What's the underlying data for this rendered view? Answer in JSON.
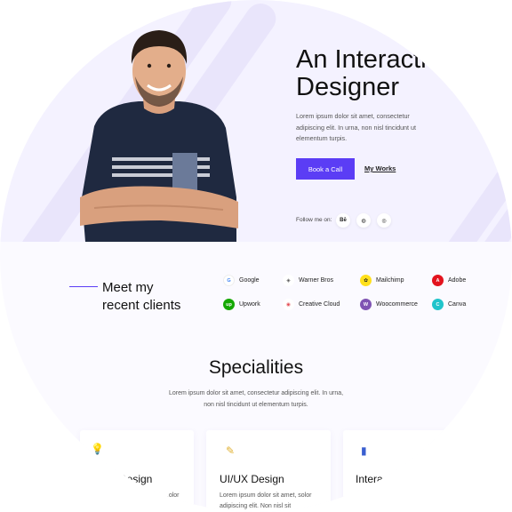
{
  "hero": {
    "headline_line1": "An Interactiv",
    "headline_line2": "Designer",
    "description": "Lorem ipsum dolor sit amet, consectetur adipiscing elit. In urna, non nisl tincidunt ut elementum turpis.",
    "primary_button": "Book a Call",
    "secondary_link": "My Works",
    "follow_label": "Follow me on:",
    "social": [
      {
        "icon": "behance-icon",
        "glyph": "Bē"
      },
      {
        "icon": "dribbble-icon",
        "glyph": "◍"
      },
      {
        "icon": "instagram-icon",
        "glyph": "◎"
      }
    ]
  },
  "clients": {
    "title_line1": "Meet my",
    "title_line2": "recent clients",
    "items": [
      {
        "name": "Google",
        "icon": "google-icon",
        "glyph": "G",
        "color": "#ffffff"
      },
      {
        "name": "Warner Bros",
        "icon": "warner-bros-icon",
        "glyph": "◈",
        "color": "#ffffff"
      },
      {
        "name": "Mailchimp",
        "icon": "mailchimp-icon",
        "glyph": "✿",
        "color": "#ffe01b"
      },
      {
        "name": "Adobe",
        "icon": "adobe-icon",
        "glyph": "A",
        "color": "#e3131e"
      },
      {
        "name": "Upwork",
        "icon": "upwork-icon",
        "glyph": "up",
        "color": "#14a800"
      },
      {
        "name": "Creative Cloud",
        "icon": "creative-cloud-icon",
        "glyph": "◉",
        "color": "#ffffff"
      },
      {
        "name": "Woocommerce",
        "icon": "woocommerce-icon",
        "glyph": "W",
        "color": "#7f54b3"
      },
      {
        "name": "Canva",
        "icon": "canva-icon",
        "glyph": "C",
        "color": "#20c4cb"
      }
    ]
  },
  "specialities": {
    "title": "Specialities",
    "description": "Lorem ipsum dolor sit amet, consectetur adipiscing elit. In urna, non nisl tincidunt ut elementum turpis.",
    "cards": [
      {
        "title": "Design",
        "text1": "...olor",
        "icon": "lightbulb-icon",
        "glyph": "💡"
      },
      {
        "title": "UI/UX Design",
        "text1": "Lorem ipsum dolor sit amet, solor",
        "text2": "adipiscing elit. Non nisl sit",
        "icon": "design-tools-icon",
        "glyph": "✎"
      },
      {
        "title": "Intera",
        "icon": "interaction-icon",
        "glyph": "▮"
      }
    ]
  },
  "colors": {
    "accent": "#5b3df5",
    "hero_bg": "#f4f2ff"
  }
}
